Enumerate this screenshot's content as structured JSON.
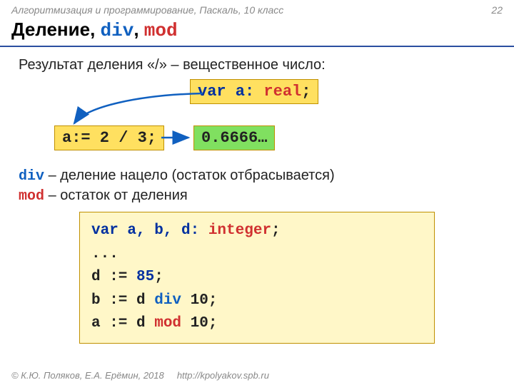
{
  "header": {
    "breadcrumb": "Алгоритмизация и программирование, Паскаль, 10 класс",
    "page": "22"
  },
  "title": {
    "main": "Деление, ",
    "kw1": "div",
    "sep": ", ",
    "kw2": "mod"
  },
  "intro": "Результат деления «/» – вещественное число:",
  "var_decl": {
    "pre": "var a: ",
    "type": "real",
    "post": ";"
  },
  "assign": "a:= 2 / 3;",
  "result": "0.6666…",
  "divline": {
    "kw": "div",
    "text": " – деление нацело (остаток отбрасывается)"
  },
  "modline": {
    "kw": "mod",
    "text": " – остаток от деления"
  },
  "code": {
    "l1a": "var a, b, d: ",
    "l1b": "integer",
    "l1c": ";",
    "l2": "...",
    "l3a": "d := ",
    "l3b": "85",
    "l3c": ";",
    "l4a": "b := d ",
    "l4b": "div",
    "l4c": " 10;",
    "l5a": "a := d ",
    "l5b": "mod",
    "l5c": " 10;"
  },
  "footer": {
    "copyright": "© К.Ю. Поляков, Е.А. Ерёмин, 2018",
    "url": "http://kpolyakov.spb.ru"
  }
}
